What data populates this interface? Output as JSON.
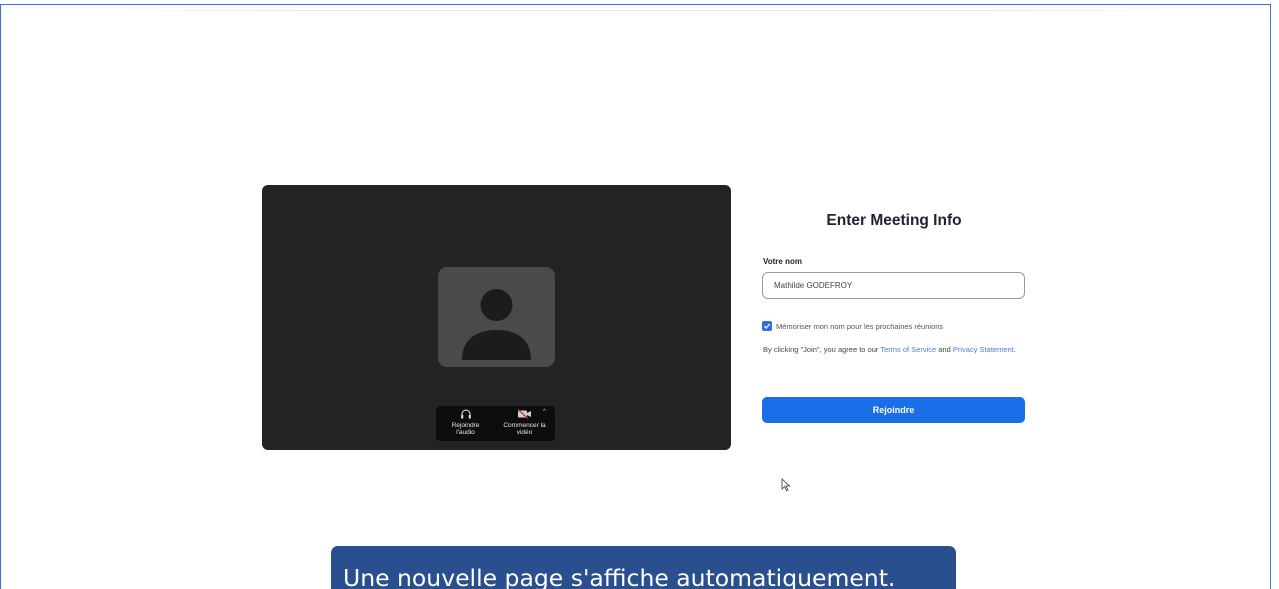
{
  "preview": {
    "icons": {
      "avatar": "person-silhouette-icon",
      "audio": "headphones-icon",
      "video": "video-camera-off-icon",
      "caret": "caret-up-icon"
    },
    "controls": {
      "join_audio_label": "Rejoindre\nl'audio",
      "start_video_label": "Commencer la\nvidéo"
    }
  },
  "form": {
    "title": "Enter Meeting Info",
    "name_label": "Votre nom",
    "name_value": "Mathilde GODEFROY",
    "remember_checked": true,
    "remember_label": "Mémoriser mon nom pour les prochaines réunions",
    "legal_prefix": "By clicking \"Join\", you agree to our ",
    "terms_link": "Terms of Service",
    "legal_and": " and ",
    "privacy_link": "Privacy Statement",
    "legal_suffix": ".",
    "join_button": "Rejoindre"
  },
  "subtitle": "Une nouvelle page s'affiche automatiquement.",
  "colors": {
    "accent": "#1a6ee8",
    "preview_bg": "#232323",
    "subtitle_bg": "#2a4f8f",
    "link": "#4a7fd4"
  }
}
